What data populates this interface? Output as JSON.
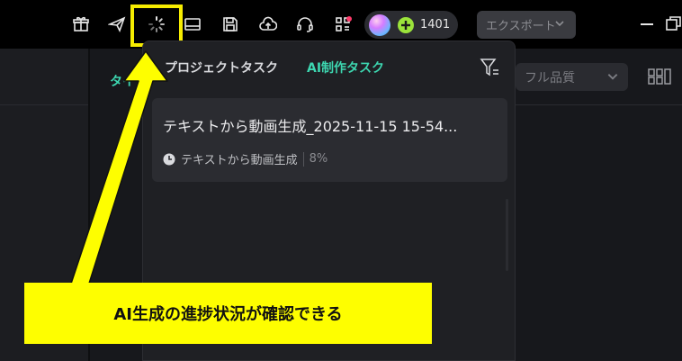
{
  "titlebar": {
    "icons": [
      "gift-icon",
      "send-icon",
      "loading-spinner-icon",
      "layout-icon",
      "save-icon",
      "cloud-upload-icon",
      "headset-icon",
      "qr-grid-icon"
    ],
    "credits": "1401",
    "export_label": "エクスポート"
  },
  "editor": {
    "partial_tab_label": "タイ",
    "quality_label": "フル品質"
  },
  "task_panel": {
    "tabs": [
      "プロジェクトタスク",
      "AI制作タスク"
    ],
    "active_tab": "AI制作タスク",
    "tasks": [
      {
        "title": "テキストから動画生成_2025-11-15 15-54...",
        "type": "テキストから動画生成",
        "progress": "8%"
      }
    ]
  },
  "annotation": {
    "callout_text": "AI生成の進捗状況が確認できる"
  },
  "colors": {
    "accent": "#3dd6b0",
    "highlight": "#fefe00",
    "panel_bg": "#1f2024",
    "card_bg": "#2b2c31"
  }
}
